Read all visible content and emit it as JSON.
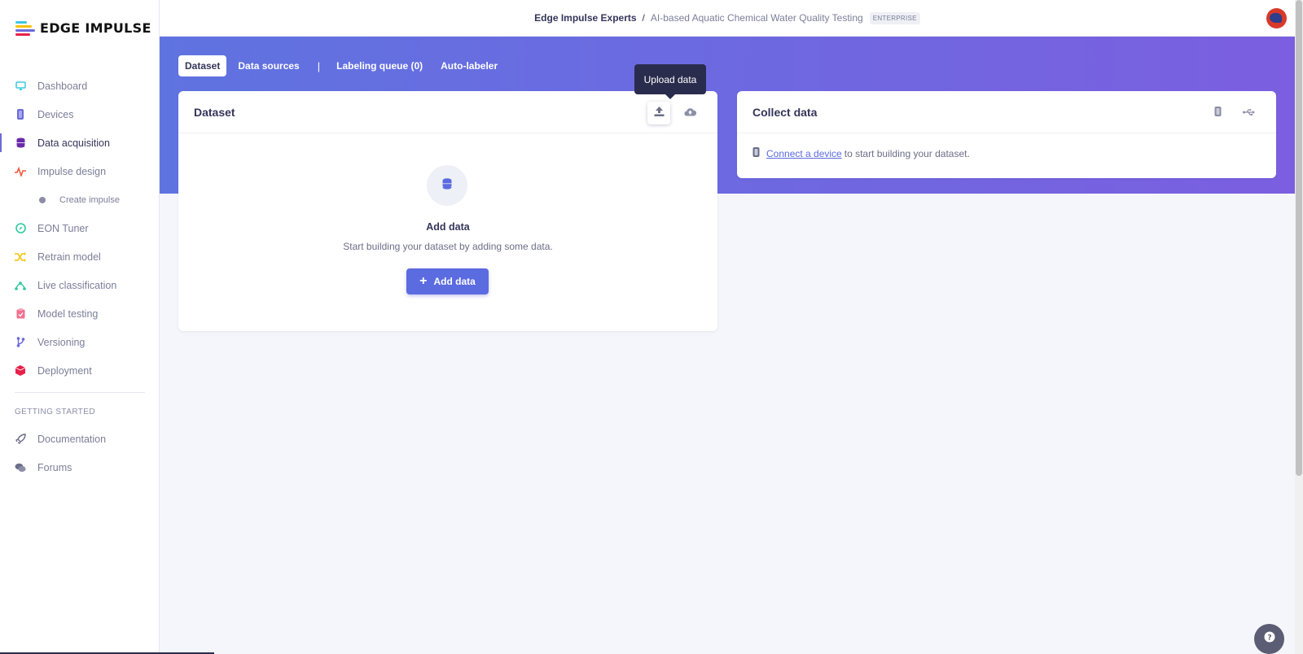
{
  "app": {
    "logo_text": "EDGE IMPULSE"
  },
  "topbar": {
    "org": "Edge Impulse Experts",
    "separator": "/",
    "project": "AI-based Aquatic Chemical Water Quality Testing",
    "badge": "ENTERPRISE"
  },
  "sidebar": {
    "items": [
      {
        "label": "Dashboard",
        "icon": "monitor-icon",
        "color": "#3cc8e0"
      },
      {
        "label": "Devices",
        "icon": "chip-icon",
        "color": "#6b6bd9"
      },
      {
        "label": "Data acquisition",
        "icon": "database-icon",
        "color": "#6a2aa8",
        "active": true
      },
      {
        "label": "Impulse design",
        "icon": "pulse-icon",
        "color": "#f05a3c"
      },
      {
        "label": "Create impulse",
        "icon": "dot-icon",
        "sub": true
      },
      {
        "label": "EON Tuner",
        "icon": "compass-icon",
        "color": "#2cc9a0"
      },
      {
        "label": "Retrain model",
        "icon": "shuffle-icon",
        "color": "#f5c200"
      },
      {
        "label": "Live classification",
        "icon": "graph-icon",
        "color": "#2cc9a0"
      },
      {
        "label": "Model testing",
        "icon": "clipboard-icon",
        "color": "#f07090"
      },
      {
        "label": "Versioning",
        "icon": "branch-icon",
        "color": "#6b6bd9"
      },
      {
        "label": "Deployment",
        "icon": "cube-icon",
        "color": "#e8204a"
      }
    ],
    "section_label": "GETTING STARTED",
    "getting_started": [
      {
        "label": "Documentation",
        "icon": "rocket-icon"
      },
      {
        "label": "Forums",
        "icon": "chat-icon"
      }
    ]
  },
  "tabs": [
    "Dataset",
    "Data sources",
    "Labeling queue (0)",
    "Auto-labeler"
  ],
  "tab_separator": "|",
  "dataset_card": {
    "title": "Dataset",
    "tooltip": "Upload data",
    "empty_title": "Add data",
    "empty_subtitle": "Start building your dataset by adding some data.",
    "add_button": "Add data"
  },
  "collect_card": {
    "title": "Collect data",
    "link_text": "Connect a device",
    "rest_text": "to start building your dataset."
  },
  "colors": {
    "accent": "#5b6be0",
    "hero_start": "#5f73e0",
    "hero_end": "#7b5fe0"
  }
}
